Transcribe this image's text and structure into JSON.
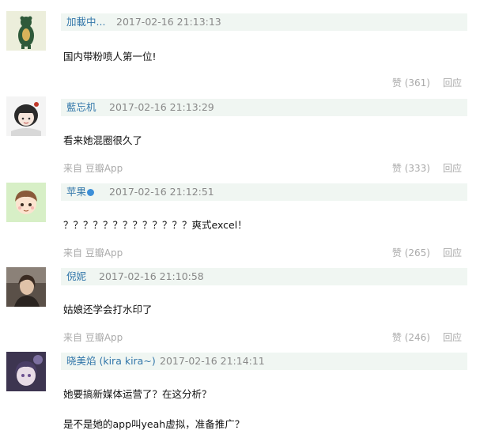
{
  "comments": [
    {
      "author": "加載中...",
      "time": "2017-02-16 21:13:13",
      "lines": [
        "国内带粉喷人第一位!"
      ],
      "source": "",
      "like": "赞 (361)",
      "reply": "回应"
    },
    {
      "author": "藍忘机",
      "time": "2017-02-16 21:13:29",
      "lines": [
        "看来她混圈很久了"
      ],
      "source": "来自 豆瓣App",
      "like": "赞 (333)",
      "reply": "回应"
    },
    {
      "author": "苹果",
      "time": "2017-02-16 21:12:51",
      "lines": [
        "？？？？？？？？？？？？？爽式excel！"
      ],
      "source": "来自 豆瓣App",
      "like": "赞 (265)",
      "reply": "回应"
    },
    {
      "author": "倪妮",
      "time": "2017-02-16 21:10:58",
      "lines": [
        "姑娘还学会打水印了"
      ],
      "source": "来自 豆瓣App",
      "like": "赞 (246)",
      "reply": "回应"
    },
    {
      "author": "晓美焰 (kira kira~)",
      "time": "2017-02-16 21:14:11",
      "lines": [
        "她要搞新媒体运营了？在这分析？",
        "是不是她的app叫yeah虚拟，准备推广？"
      ],
      "source": "",
      "like": "",
      "reply": ""
    }
  ]
}
